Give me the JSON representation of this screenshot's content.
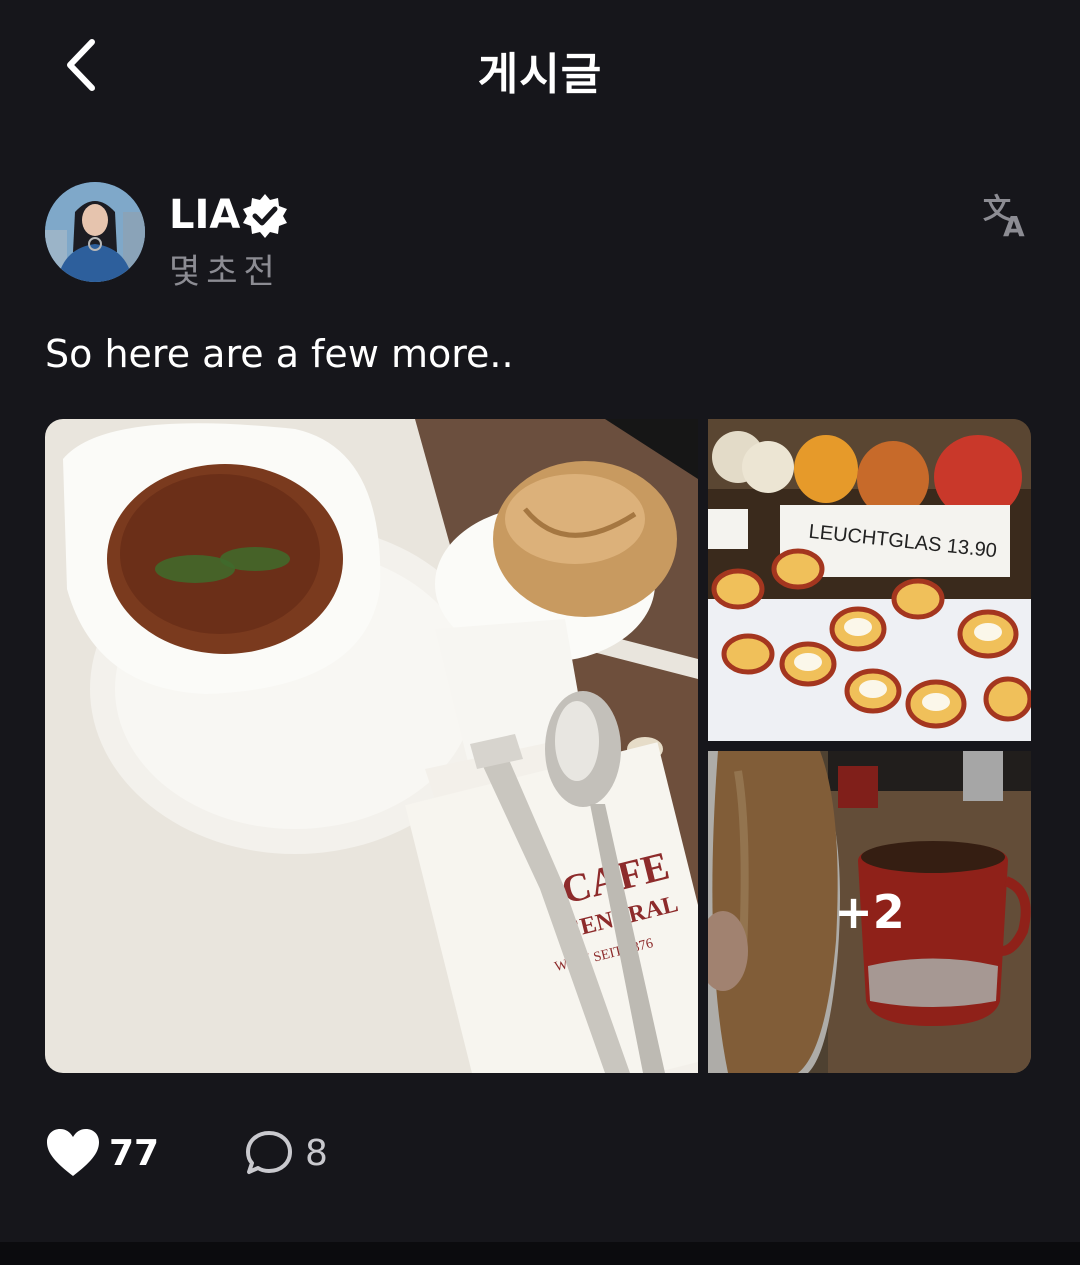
{
  "header": {
    "title": "게시글",
    "back_icon": "chevron-left-icon"
  },
  "author": {
    "name": "LIA",
    "verified_icon": "verified-badge-icon",
    "timestamp": "몇초전",
    "avatar_icon": "avatar",
    "translate_icon": "translate-icon"
  },
  "post": {
    "text": "So here are a few more..",
    "photos": [
      {
        "name": "soup-photo"
      },
      {
        "name": "candle-holders-photo"
      },
      {
        "name": "bread-and-mug-photo",
        "overlay": "+2"
      }
    ]
  },
  "actions": {
    "likes": "77",
    "like_icon": "heart-icon",
    "comments": "8",
    "comment_icon": "comment-icon"
  },
  "colors": {
    "background": "#16161b",
    "text": "#ffffff",
    "muted": "#8c8c93"
  }
}
